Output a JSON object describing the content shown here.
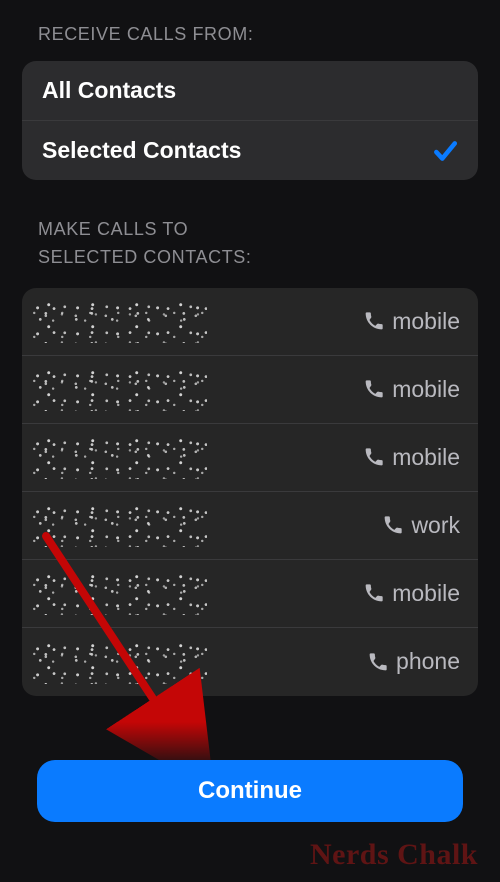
{
  "receive": {
    "header": "Receive Calls From:",
    "options": [
      {
        "label": "All Contacts",
        "selected": false
      },
      {
        "label": "Selected Contacts",
        "selected": true
      }
    ]
  },
  "make": {
    "header_line1": "Make Calls to",
    "header_line2": "Selected Contacts:",
    "contacts": [
      {
        "name": "[redacted]",
        "type": "mobile"
      },
      {
        "name": "[redacted]",
        "type": "mobile"
      },
      {
        "name": "[redacted]",
        "type": "mobile"
      },
      {
        "name": "[redacted]",
        "type": "work"
      },
      {
        "name": "[redacted]",
        "type": "mobile"
      },
      {
        "name": "[redacted]",
        "type": "phone"
      }
    ]
  },
  "continue_label": "Continue",
  "watermark": "Nerds Chalk",
  "colors": {
    "accent_blue": "#0a7bff",
    "check_blue": "#0a7bff",
    "arrow_red": "#c40606"
  },
  "annotation": {
    "arrow_points_to": "continue-button"
  }
}
